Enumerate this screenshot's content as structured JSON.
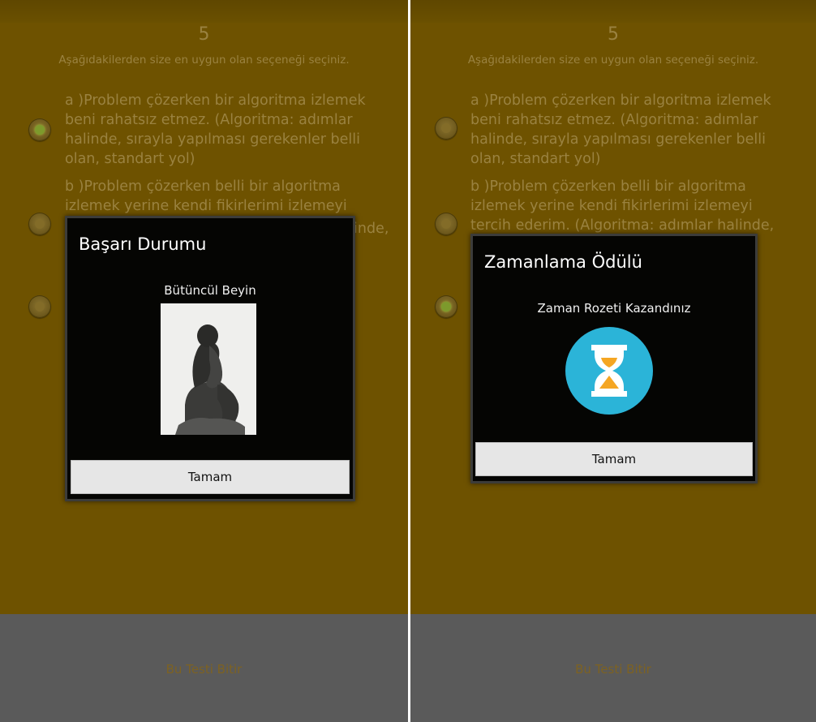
{
  "left": {
    "question_number": "5",
    "instruction": "Aşağıdakilerden size en uygun olan seçeneği seçiniz.",
    "option_a_lines": [
      "a )Problem çözerken bir algoritma izlemek",
      "beni rahatsız etmez. (Algoritma: adımlar",
      "halinde, sırayla yapılması gerekenler belli",
      "olan, standart yol)"
    ],
    "option_b_lines": [
      "b )Problem çözerken belli bir algoritma",
      "izlemek yerine kendi fikirlerimi izlemeyi",
      "inde,"
    ],
    "finish_button": "Bu Testi Bitir",
    "dialog": {
      "title": "Başarı Durumu",
      "message": "Bütüncül Beyin",
      "image_icon": "thinker-statue-icon",
      "ok_label": "Tamam"
    }
  },
  "right": {
    "question_number": "5",
    "instruction": "Aşağıdakilerden size en uygun olan seçeneği seçiniz.",
    "option_a_lines": [
      "a )Problem çözerken bir algoritma izlemek",
      "beni rahatsız etmez. (Algoritma: adımlar",
      "halinde, sırayla yapılması gerekenler belli",
      "olan, standart yol)"
    ],
    "option_b_lines": [
      "b )Problem çözerken belli bir algoritma",
      "izlemek yerine kendi fikirlerimi izlemeyi",
      "tercih ederim. (Algoritma: adımlar halinde,"
    ],
    "finish_button": "Bu Testi Bitir",
    "dialog": {
      "title": "Zamanlama Ödülü",
      "message": "Zaman Rozeti Kazandınız",
      "image_icon": "hourglass-icon",
      "ok_label": "Tamam"
    }
  },
  "colors": {
    "background": "#6e5200",
    "radio_selected": "#7d9a2c",
    "hourglass_circle": "#2bb4d8",
    "hourglass_sand": "#f5a623"
  }
}
